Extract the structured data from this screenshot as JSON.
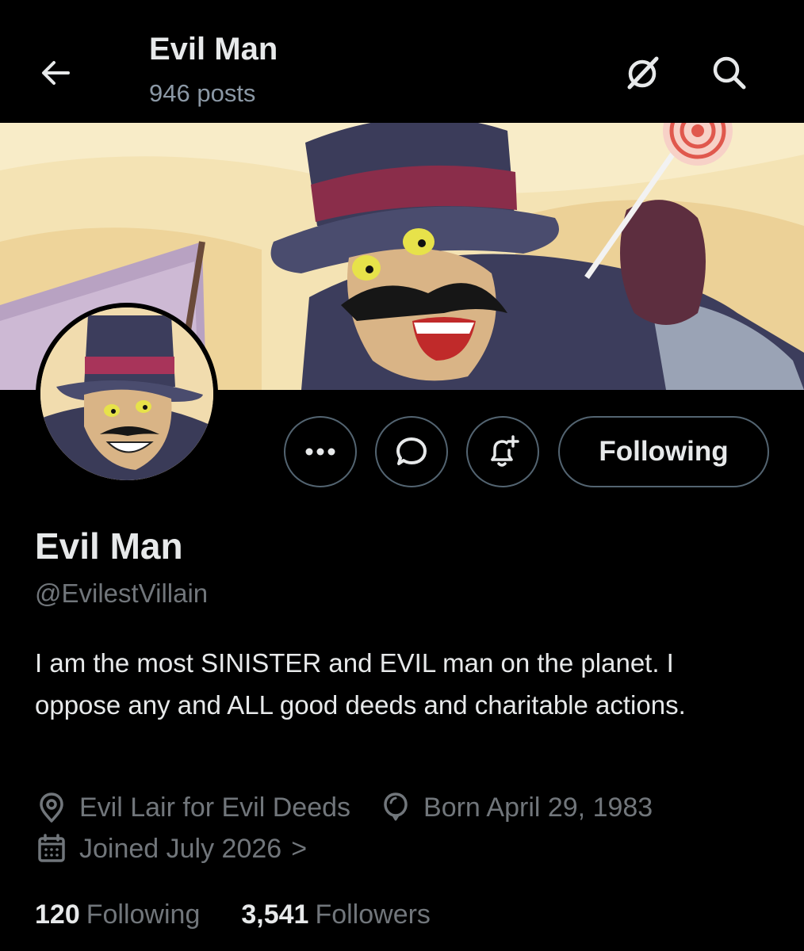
{
  "header": {
    "title": "Evil Man",
    "post_count": "946 posts",
    "back_icon": "arrow-left-icon",
    "grok_icon": "grok-icon",
    "search_icon": "search-icon"
  },
  "profile": {
    "display_name": "Evil Man",
    "handle": "@EvilestVillain",
    "bio": "I am the most SINISTER and EVIL man on the planet. I oppose any and ALL good deeds and charitable actions.",
    "location": "Evil Lair for Evil Deeds",
    "birthday": "Born April 29, 1983",
    "joined": "Joined July 2026",
    "joined_chevron": ">",
    "following_count": "120",
    "following_label": "Following",
    "followers_count": "3,541",
    "followers_label": "Followers"
  },
  "actions": {
    "more_icon": "more-icon",
    "message_icon": "message-icon",
    "notify_icon": "bell-plus-icon",
    "follow_label": "Following"
  },
  "colors": {
    "background": "#000000",
    "text": "#e7e9ea",
    "secondary": "#71767b",
    "border": "#536471",
    "banner_sky": "#f3e2b8"
  }
}
